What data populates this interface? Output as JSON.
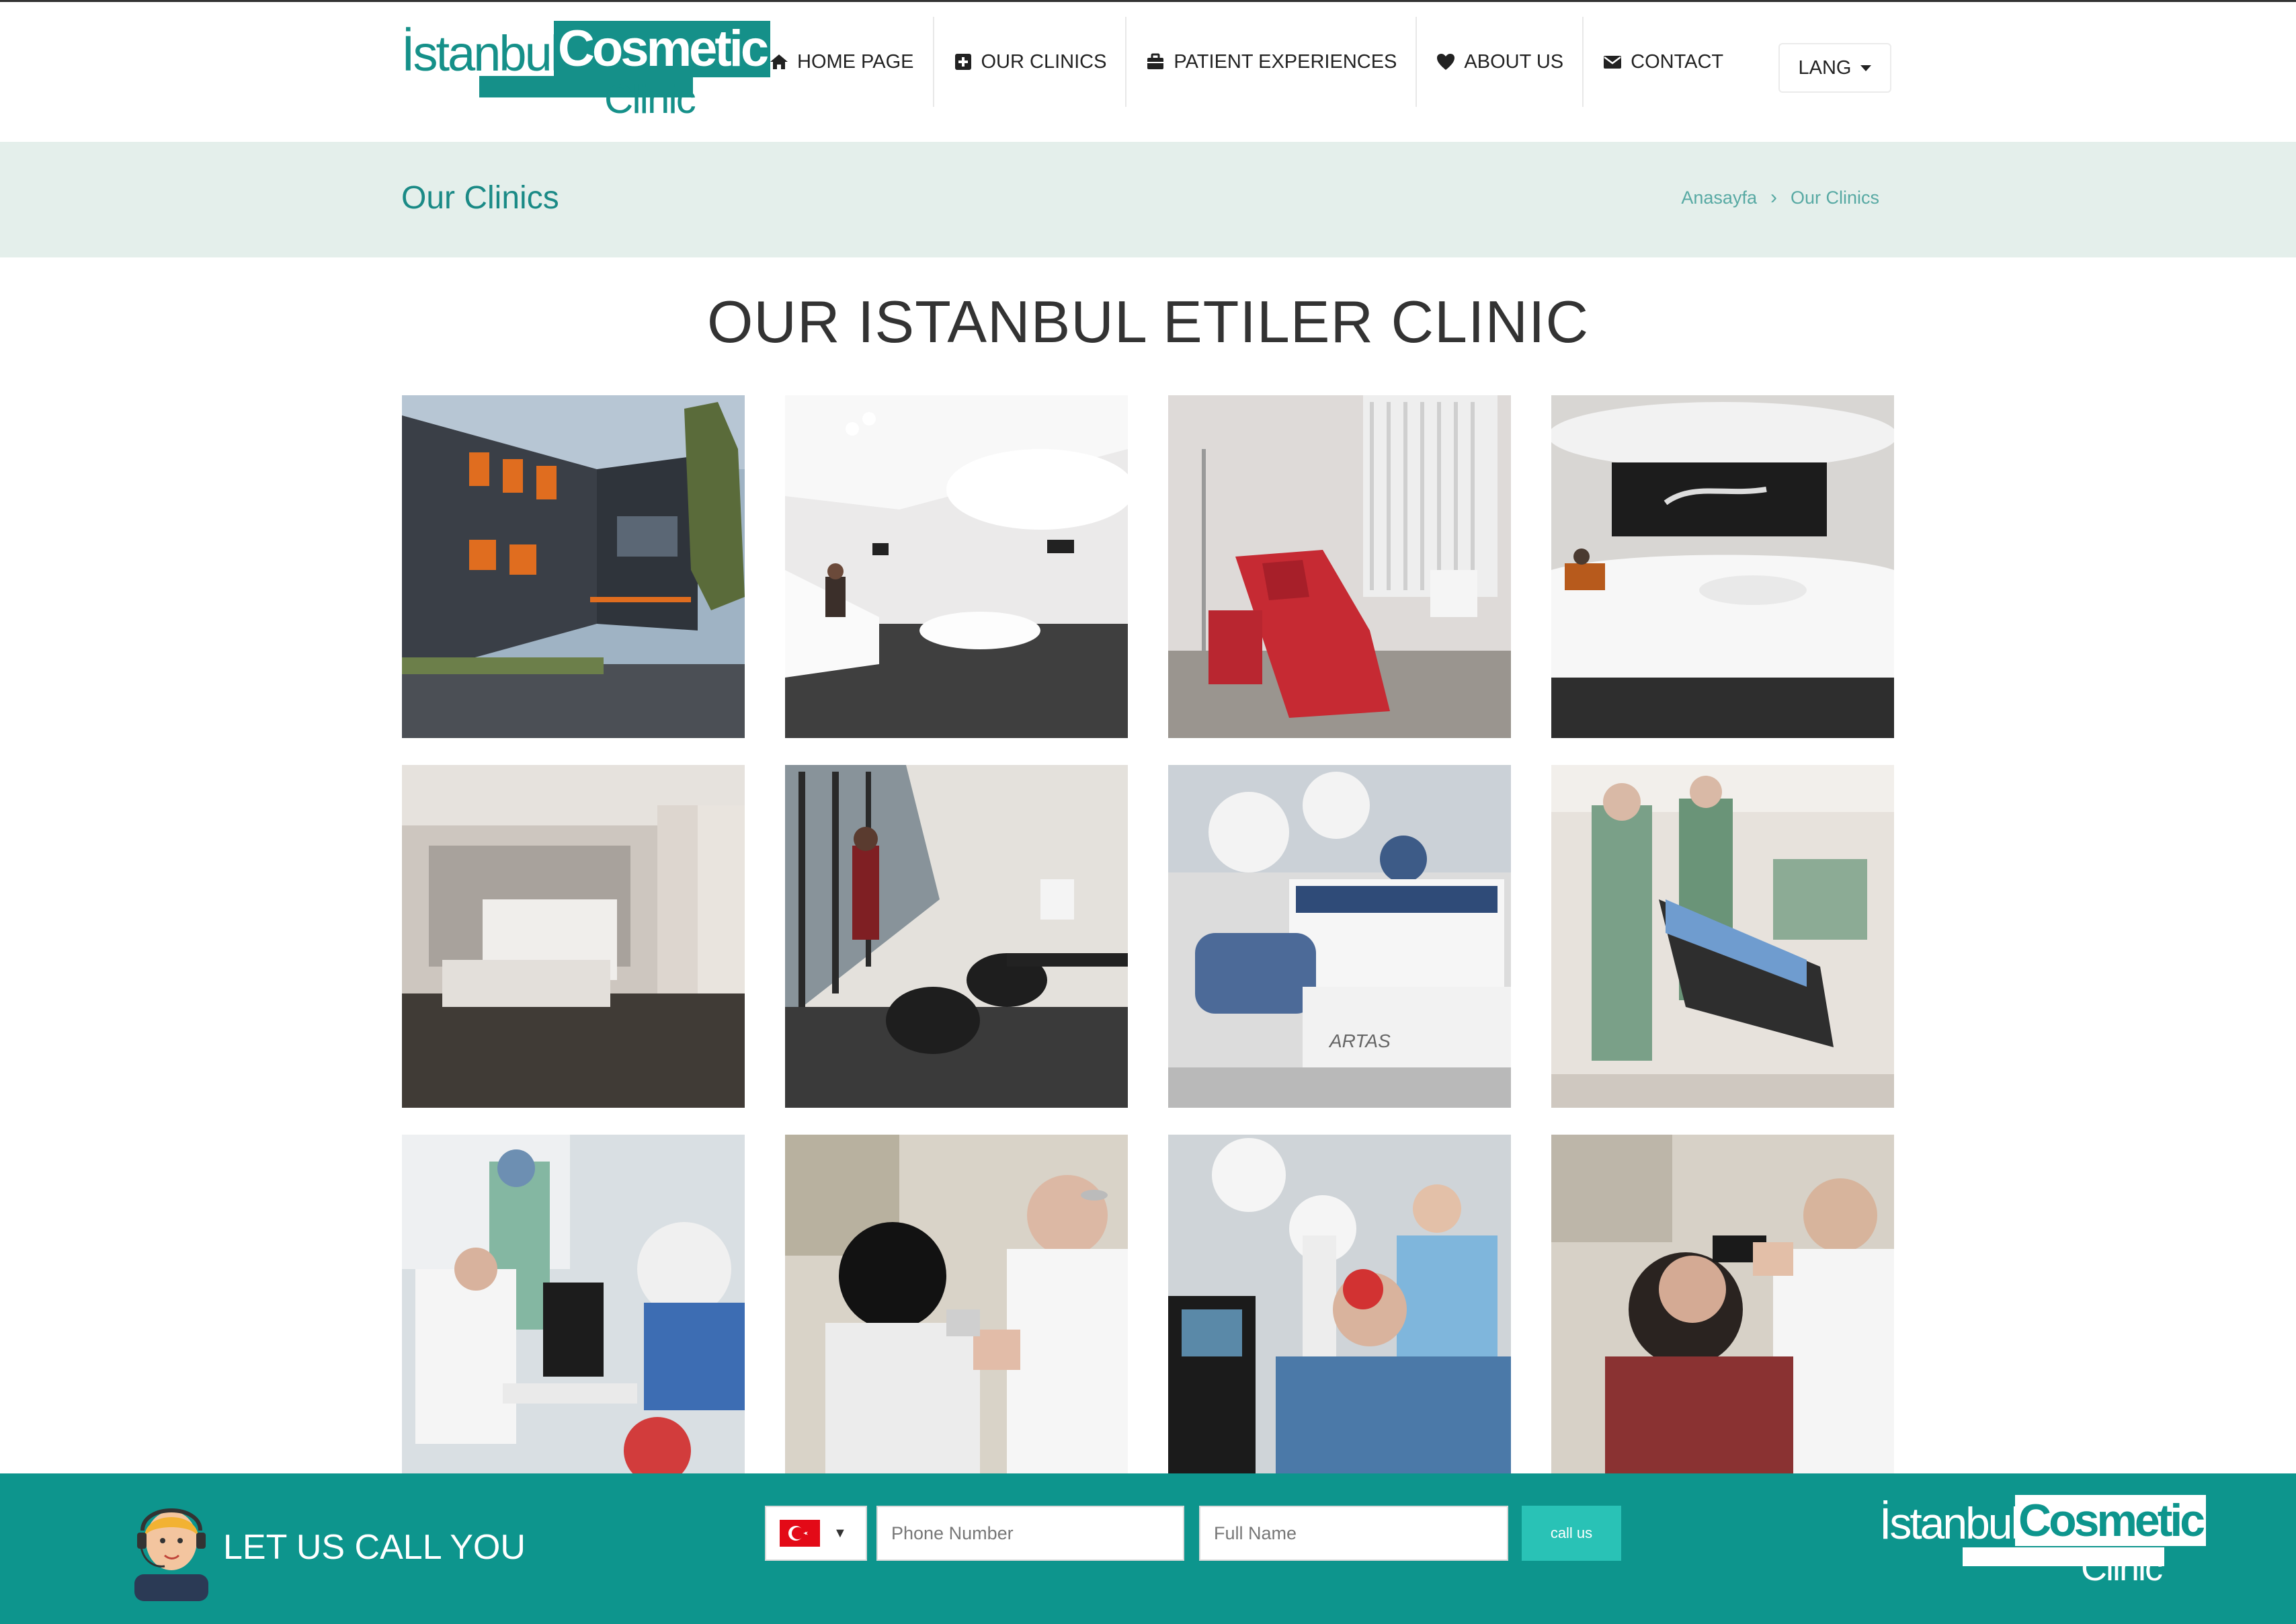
{
  "logo": {
    "word1": "İstanbul",
    "word2": "Cosmetic",
    "word3": "Clinic"
  },
  "nav": {
    "items": [
      {
        "label": "HOME PAGE",
        "icon": "home-icon"
      },
      {
        "label": "OUR CLINICS",
        "icon": "plus-square-icon"
      },
      {
        "label": "PATIENT EXPERIENCES",
        "icon": "briefcase-icon"
      },
      {
        "label": "ABOUT US",
        "icon": "heart-icon"
      },
      {
        "label": "CONTACT",
        "icon": "envelope-icon"
      }
    ],
    "lang_label": "LANG"
  },
  "page": {
    "title": "Our Clinics",
    "breadcrumb": {
      "home": "Anasayfa",
      "sep": "›",
      "current": "Our Clinics"
    },
    "heading": "OUR ISTANBUL ETILER CLINIC"
  },
  "footer": {
    "callus_label": "LET US CALL YOU",
    "country_flag": "turkey-flag",
    "phone_placeholder": "Phone Number",
    "name_placeholder": "Full Name",
    "call_button": "call us"
  },
  "colors": {
    "brand": "#159089",
    "footer_bg": "#0d958d",
    "crumb_bg": "#e4efeb",
    "button": "#29c2b6"
  }
}
